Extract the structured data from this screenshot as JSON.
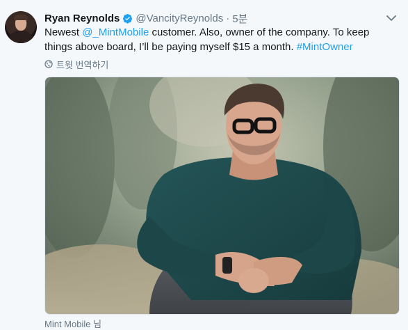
{
  "tweet": {
    "author_name": "Ryan Reynolds",
    "author_handle": "@VancityReynolds",
    "separator": "·",
    "time": "5분",
    "text_parts": {
      "p1": "Newest ",
      "mention": "@_MintMobile",
      "p2": " customer. Also, owner of the company. To keep things above board, I’ll be paying myself $15 a month. ",
      "hashtag": "#MintOwner"
    },
    "translate_label": "트윗 번역하기",
    "caption": "Mint Mobile 님"
  },
  "icons": {
    "verified": "verified-badge-icon",
    "menu": "chevron-down-icon",
    "translate": "globe-icon",
    "avatar": "avatar"
  },
  "colors": {
    "link": "#1da1f2",
    "muted": "#657786",
    "background": "#f5f8fa",
    "sweater": "#1f4a4c"
  }
}
